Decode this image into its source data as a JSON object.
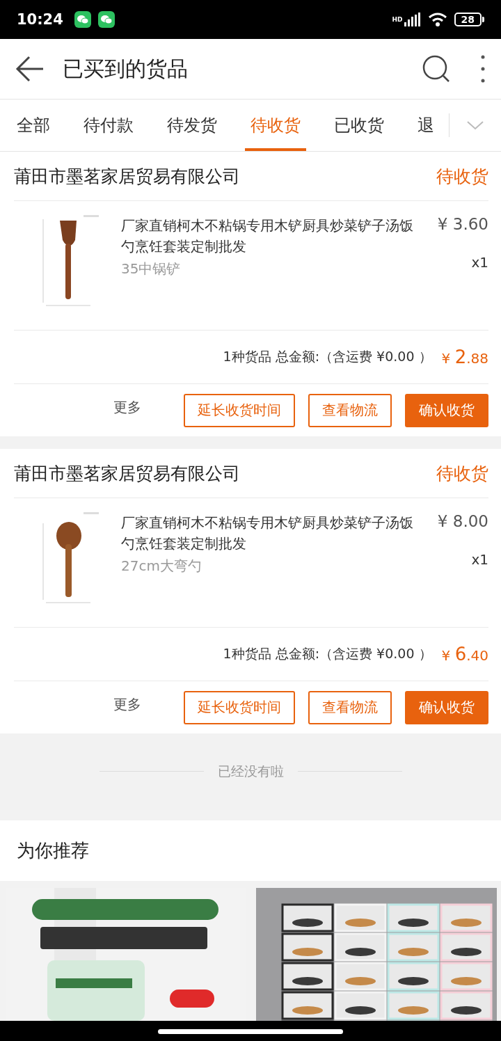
{
  "status_bar": {
    "time": "10:24",
    "network": "HD",
    "battery": "28"
  },
  "header": {
    "title": "已买到的货品"
  },
  "tabs": [
    {
      "label": "全部",
      "selected": false
    },
    {
      "label": "待付款",
      "selected": false
    },
    {
      "label": "待发货",
      "selected": false
    },
    {
      "label": "待收货",
      "selected": true
    },
    {
      "label": "已收货",
      "selected": false
    },
    {
      "label": "退",
      "selected": false
    }
  ],
  "orders": [
    {
      "store": "莆田市墨茗家居贸易有限公司",
      "status": "待收货",
      "product": {
        "kind": "picture",
        "title": "厂家直销柯木不粘锅专用木铲厨具炒菜铲子汤饭勺烹饪套装定制批发",
        "option": "35中锅铲",
        "price": "¥ 3.60",
        "quantity": "x1"
      },
      "summary": "1种货品 总金额:（含运费 ¥0.00 ）",
      "total": {
        "currency": "¥",
        "whole": "2",
        "fraction": ".88"
      },
      "more": "更多",
      "actions": [
        {
          "label": "延长收货时间",
          "kind": "outline"
        },
        {
          "label": "查看物流",
          "kind": "outline"
        },
        {
          "label": "确认收货",
          "kind": "primary"
        }
      ]
    },
    {
      "store": "莆田市墨茗家居贸易有限公司",
      "status": "待收货",
      "product": {
        "kind": "picture",
        "title": "厂家直销柯木不粘锅专用木铲厨具炒菜铲子汤饭勺烹饪套装定制批发",
        "option": "27cm大弯勺",
        "price": "¥ 8.00",
        "quantity": "x1"
      },
      "summary": "1种货品 总金额:（含运费 ¥0.00 ）",
      "total": {
        "currency": "¥",
        "whole": "6",
        "fraction": ".40"
      },
      "more": "更多",
      "actions": [
        {
          "label": "延长收货时间",
          "kind": "outline"
        },
        {
          "label": "查看物流",
          "kind": "outline"
        },
        {
          "label": "确认收货",
          "kind": "primary"
        }
      ]
    }
  ],
  "end_note": "已经没有啦",
  "recommend": {
    "title": "为你推荐"
  }
}
